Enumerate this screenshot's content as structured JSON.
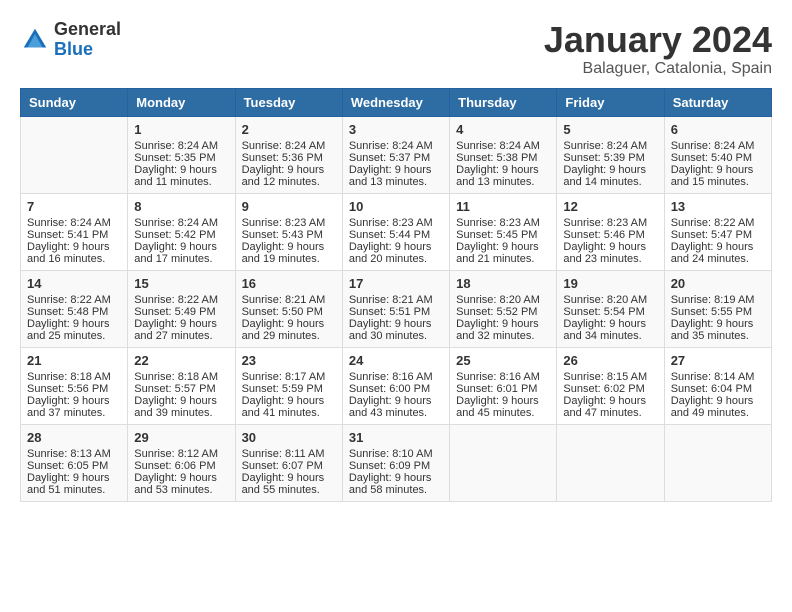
{
  "header": {
    "logo_general": "General",
    "logo_blue": "Blue",
    "title": "January 2024",
    "location": "Balaguer, Catalonia, Spain"
  },
  "days_of_week": [
    "Sunday",
    "Monday",
    "Tuesday",
    "Wednesday",
    "Thursday",
    "Friday",
    "Saturday"
  ],
  "weeks": [
    [
      {
        "day": "",
        "info": ""
      },
      {
        "day": "1",
        "info": "Sunrise: 8:24 AM\nSunset: 5:35 PM\nDaylight: 9 hours\nand 11 minutes."
      },
      {
        "day": "2",
        "info": "Sunrise: 8:24 AM\nSunset: 5:36 PM\nDaylight: 9 hours\nand 12 minutes."
      },
      {
        "day": "3",
        "info": "Sunrise: 8:24 AM\nSunset: 5:37 PM\nDaylight: 9 hours\nand 13 minutes."
      },
      {
        "day": "4",
        "info": "Sunrise: 8:24 AM\nSunset: 5:38 PM\nDaylight: 9 hours\nand 13 minutes."
      },
      {
        "day": "5",
        "info": "Sunrise: 8:24 AM\nSunset: 5:39 PM\nDaylight: 9 hours\nand 14 minutes."
      },
      {
        "day": "6",
        "info": "Sunrise: 8:24 AM\nSunset: 5:40 PM\nDaylight: 9 hours\nand 15 minutes."
      }
    ],
    [
      {
        "day": "7",
        "info": "Sunrise: 8:24 AM\nSunset: 5:41 PM\nDaylight: 9 hours\nand 16 minutes."
      },
      {
        "day": "8",
        "info": "Sunrise: 8:24 AM\nSunset: 5:42 PM\nDaylight: 9 hours\nand 17 minutes."
      },
      {
        "day": "9",
        "info": "Sunrise: 8:23 AM\nSunset: 5:43 PM\nDaylight: 9 hours\nand 19 minutes."
      },
      {
        "day": "10",
        "info": "Sunrise: 8:23 AM\nSunset: 5:44 PM\nDaylight: 9 hours\nand 20 minutes."
      },
      {
        "day": "11",
        "info": "Sunrise: 8:23 AM\nSunset: 5:45 PM\nDaylight: 9 hours\nand 21 minutes."
      },
      {
        "day": "12",
        "info": "Sunrise: 8:23 AM\nSunset: 5:46 PM\nDaylight: 9 hours\nand 23 minutes."
      },
      {
        "day": "13",
        "info": "Sunrise: 8:22 AM\nSunset: 5:47 PM\nDaylight: 9 hours\nand 24 minutes."
      }
    ],
    [
      {
        "day": "14",
        "info": "Sunrise: 8:22 AM\nSunset: 5:48 PM\nDaylight: 9 hours\nand 25 minutes."
      },
      {
        "day": "15",
        "info": "Sunrise: 8:22 AM\nSunset: 5:49 PM\nDaylight: 9 hours\nand 27 minutes."
      },
      {
        "day": "16",
        "info": "Sunrise: 8:21 AM\nSunset: 5:50 PM\nDaylight: 9 hours\nand 29 minutes."
      },
      {
        "day": "17",
        "info": "Sunrise: 8:21 AM\nSunset: 5:51 PM\nDaylight: 9 hours\nand 30 minutes."
      },
      {
        "day": "18",
        "info": "Sunrise: 8:20 AM\nSunset: 5:52 PM\nDaylight: 9 hours\nand 32 minutes."
      },
      {
        "day": "19",
        "info": "Sunrise: 8:20 AM\nSunset: 5:54 PM\nDaylight: 9 hours\nand 34 minutes."
      },
      {
        "day": "20",
        "info": "Sunrise: 8:19 AM\nSunset: 5:55 PM\nDaylight: 9 hours\nand 35 minutes."
      }
    ],
    [
      {
        "day": "21",
        "info": "Sunrise: 8:18 AM\nSunset: 5:56 PM\nDaylight: 9 hours\nand 37 minutes."
      },
      {
        "day": "22",
        "info": "Sunrise: 8:18 AM\nSunset: 5:57 PM\nDaylight: 9 hours\nand 39 minutes."
      },
      {
        "day": "23",
        "info": "Sunrise: 8:17 AM\nSunset: 5:59 PM\nDaylight: 9 hours\nand 41 minutes."
      },
      {
        "day": "24",
        "info": "Sunrise: 8:16 AM\nSunset: 6:00 PM\nDaylight: 9 hours\nand 43 minutes."
      },
      {
        "day": "25",
        "info": "Sunrise: 8:16 AM\nSunset: 6:01 PM\nDaylight: 9 hours\nand 45 minutes."
      },
      {
        "day": "26",
        "info": "Sunrise: 8:15 AM\nSunset: 6:02 PM\nDaylight: 9 hours\nand 47 minutes."
      },
      {
        "day": "27",
        "info": "Sunrise: 8:14 AM\nSunset: 6:04 PM\nDaylight: 9 hours\nand 49 minutes."
      }
    ],
    [
      {
        "day": "28",
        "info": "Sunrise: 8:13 AM\nSunset: 6:05 PM\nDaylight: 9 hours\nand 51 minutes."
      },
      {
        "day": "29",
        "info": "Sunrise: 8:12 AM\nSunset: 6:06 PM\nDaylight: 9 hours\nand 53 minutes."
      },
      {
        "day": "30",
        "info": "Sunrise: 8:11 AM\nSunset: 6:07 PM\nDaylight: 9 hours\nand 55 minutes."
      },
      {
        "day": "31",
        "info": "Sunrise: 8:10 AM\nSunset: 6:09 PM\nDaylight: 9 hours\nand 58 minutes."
      },
      {
        "day": "",
        "info": ""
      },
      {
        "day": "",
        "info": ""
      },
      {
        "day": "",
        "info": ""
      }
    ]
  ]
}
